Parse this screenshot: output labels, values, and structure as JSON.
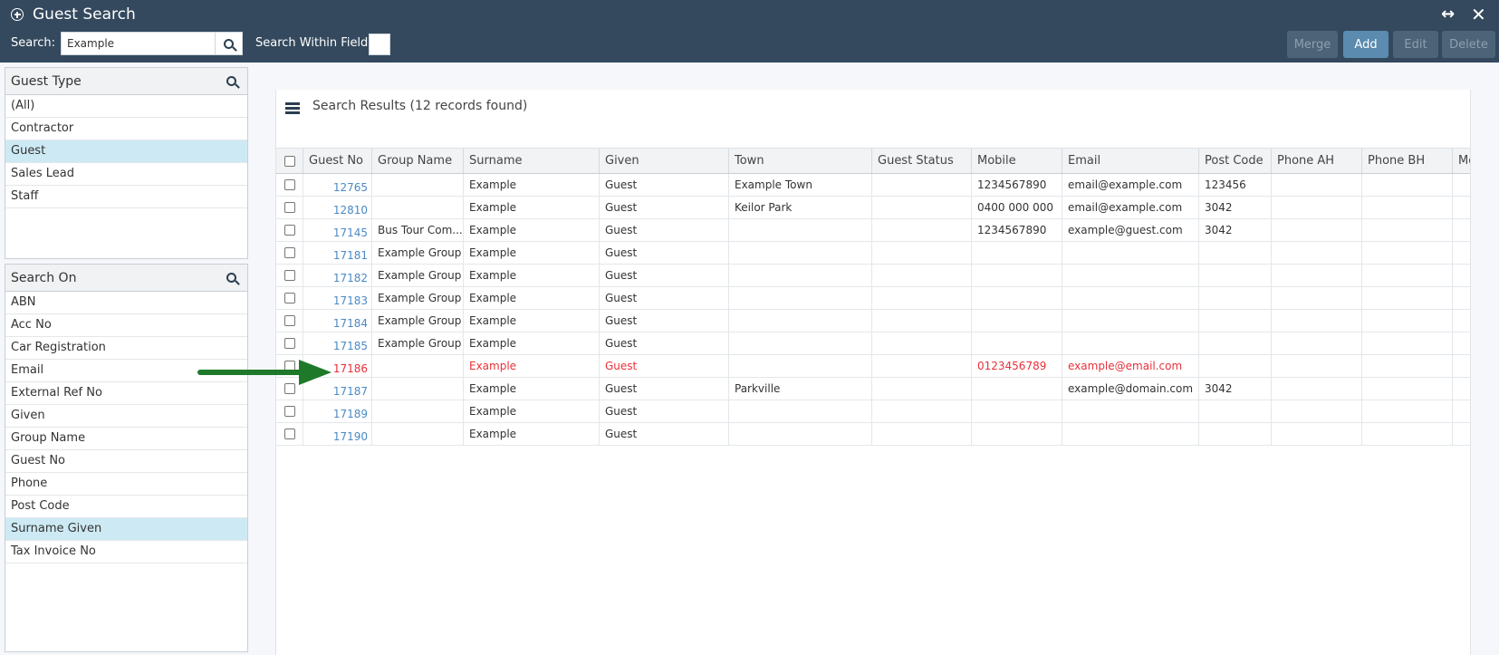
{
  "window": {
    "title": "Guest Search"
  },
  "toolbar": {
    "search_label": "Search:",
    "search_value": "Example",
    "within_label": "Search Within Field:",
    "merge_label": "Merge",
    "add_label": "Add",
    "edit_label": "Edit",
    "delete_label": "Delete"
  },
  "guest_type": {
    "title": "Guest Type",
    "items": [
      {
        "label": "(All)"
      },
      {
        "label": "Contractor"
      },
      {
        "label": "Guest",
        "selected": true
      },
      {
        "label": "Sales Lead"
      },
      {
        "label": "Staff"
      }
    ]
  },
  "search_on": {
    "title": "Search On",
    "items": [
      {
        "label": "ABN"
      },
      {
        "label": "Acc No"
      },
      {
        "label": "Car Registration"
      },
      {
        "label": "Email"
      },
      {
        "label": "External Ref No"
      },
      {
        "label": "Given"
      },
      {
        "label": "Group Name"
      },
      {
        "label": "Guest No"
      },
      {
        "label": "Phone"
      },
      {
        "label": "Post Code"
      },
      {
        "label": "Surname Given",
        "selected": true
      },
      {
        "label": "Tax Invoice No"
      }
    ]
  },
  "results": {
    "title": "Search Results (12 records found)",
    "columns": [
      "Guest No",
      "Group Name",
      "Surname",
      "Given",
      "Town",
      "Guest Status",
      "Mobile",
      "Email",
      "Post Code",
      "Phone AH",
      "Phone BH",
      "Mo"
    ],
    "rows": [
      {
        "guest_no": "12765",
        "group": "",
        "surname": "Example",
        "given": "Guest",
        "town": "Example Town",
        "status": "",
        "mobile": "1234567890",
        "email": "email@example.com",
        "postcode": "123456",
        "phone_ah": "",
        "phone_bh": ""
      },
      {
        "guest_no": "12810",
        "group": "",
        "surname": "Example",
        "given": "Guest",
        "town": "Keilor Park",
        "status": "",
        "mobile": "0400 000 000",
        "email": "email@example.com",
        "postcode": "3042",
        "phone_ah": "",
        "phone_bh": ""
      },
      {
        "guest_no": "17145",
        "group": "Bus Tour Com...",
        "surname": "Example",
        "given": "Guest",
        "town": "",
        "status": "",
        "mobile": "1234567890",
        "email": "example@guest.com",
        "postcode": "3042",
        "phone_ah": "",
        "phone_bh": ""
      },
      {
        "guest_no": "17181",
        "group": "Example Group",
        "surname": "Example",
        "given": "Guest",
        "town": "",
        "status": "",
        "mobile": "",
        "email": "",
        "postcode": "",
        "phone_ah": "",
        "phone_bh": ""
      },
      {
        "guest_no": "17182",
        "group": "Example Group",
        "surname": "Example",
        "given": "Guest",
        "town": "",
        "status": "",
        "mobile": "",
        "email": "",
        "postcode": "",
        "phone_ah": "",
        "phone_bh": ""
      },
      {
        "guest_no": "17183",
        "group": "Example Group",
        "surname": "Example",
        "given": "Guest",
        "town": "",
        "status": "",
        "mobile": "",
        "email": "",
        "postcode": "",
        "phone_ah": "",
        "phone_bh": ""
      },
      {
        "guest_no": "17184",
        "group": "Example Group",
        "surname": "Example",
        "given": "Guest",
        "town": "",
        "status": "",
        "mobile": "",
        "email": "",
        "postcode": "",
        "phone_ah": "",
        "phone_bh": ""
      },
      {
        "guest_no": "17185",
        "group": "Example Group",
        "surname": "Example",
        "given": "Guest",
        "town": "",
        "status": "",
        "mobile": "",
        "email": "",
        "postcode": "",
        "phone_ah": "",
        "phone_bh": ""
      },
      {
        "guest_no": "17186",
        "group": "",
        "surname": "Example",
        "given": "Guest",
        "town": "",
        "status": "",
        "mobile": "0123456789",
        "email": "example@email.com",
        "postcode": "",
        "phone_ah": "",
        "phone_bh": "",
        "highlight": true
      },
      {
        "guest_no": "17187",
        "group": "",
        "surname": "Example",
        "given": "Guest",
        "town": "Parkville",
        "status": "",
        "mobile": "",
        "email": "example@domain.com",
        "postcode": "3042",
        "phone_ah": "",
        "phone_bh": ""
      },
      {
        "guest_no": "17189",
        "group": "",
        "surname": "Example",
        "given": "Guest",
        "town": "",
        "status": "",
        "mobile": "",
        "email": "",
        "postcode": "",
        "phone_ah": "",
        "phone_bh": ""
      },
      {
        "guest_no": "17190",
        "group": "",
        "surname": "Example",
        "given": "Guest",
        "town": "",
        "status": "",
        "mobile": "",
        "email": "",
        "postcode": "",
        "phone_ah": "",
        "phone_bh": ""
      }
    ]
  },
  "colors": {
    "header_bg": "#34495e",
    "link_blue": "#4a8ac4",
    "highlight_red": "#e8313a",
    "selected_bg": "#cdeaf4",
    "arrow_green": "#1e7a2a"
  },
  "icons": [
    "add-circle-icon",
    "search-icon",
    "expand-icon",
    "close-icon",
    "hamburger-menu-icon",
    "arrow-annotation-icon"
  ]
}
